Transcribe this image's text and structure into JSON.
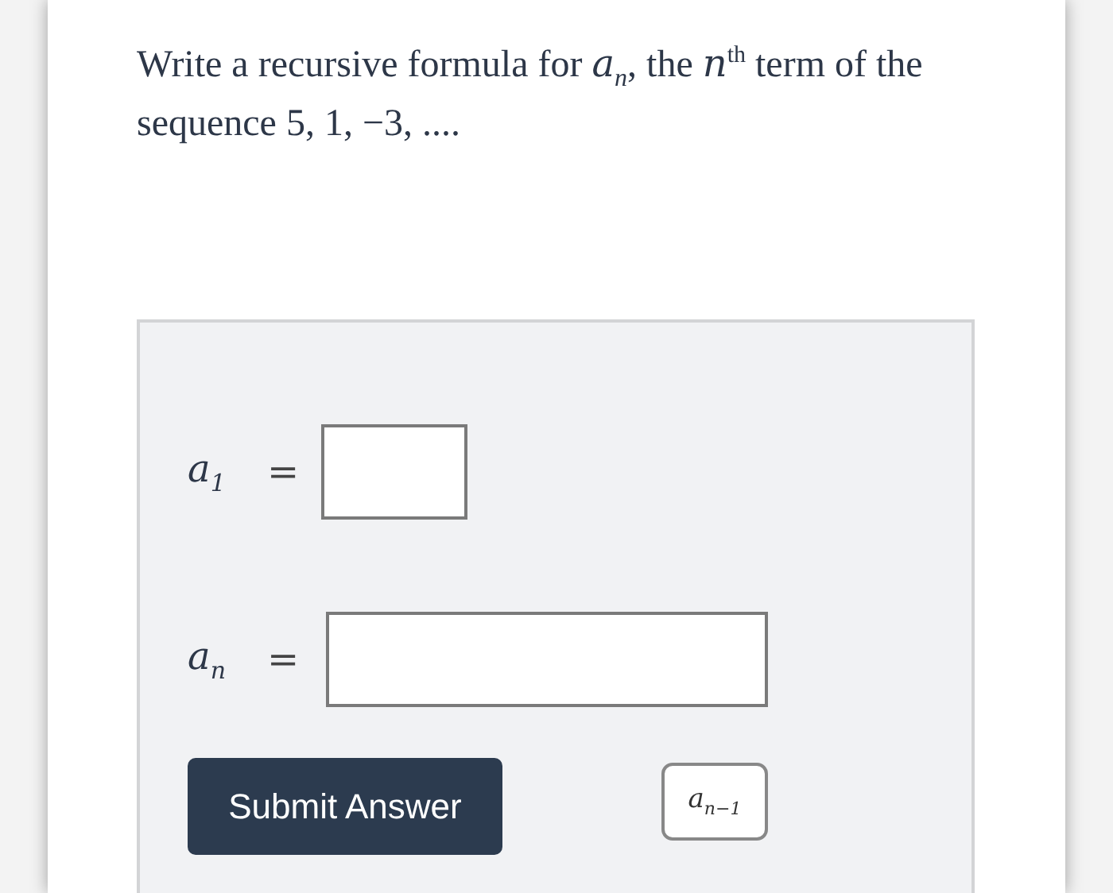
{
  "question": "Write a recursive formula for *a*$_{n}$, the *n*$^{th}$ term of the sequence 5, 1, −3, ....",
  "fields": [
    {
      "label": "*a*$_{1}$",
      "equals": "=",
      "kind": "short"
    },
    {
      "label": "*a*$_{n}$",
      "equals": "=",
      "kind": "long"
    }
  ],
  "submit_button": "Submit Answer",
  "insert_button": "*a*$_{n−1}$"
}
